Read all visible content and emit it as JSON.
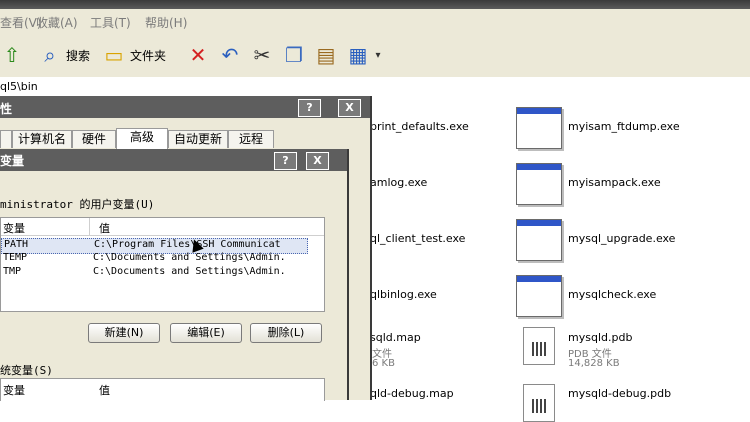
{
  "menu": [
    "查看(V)",
    "收藏(A)",
    "工具(T)",
    "帮助(H)"
  ],
  "toolbar": {
    "search_label": "搜索",
    "folders_label": "文件夹"
  },
  "address": "ql5\\bin",
  "files": {
    "col1": [
      {
        "name": "print_defaults.exe"
      },
      {
        "name": "amlog.exe"
      },
      {
        "name": "ql_client_test.exe"
      },
      {
        "name": "qlbinlog.exe"
      },
      {
        "name": "sqld.map",
        "type": "文件",
        "size": "6 KB"
      },
      {
        "name": "qld-debug.map"
      }
    ],
    "col2": [
      {
        "name": "myisam_ftdump.exe"
      },
      {
        "name": "myisampack.exe"
      },
      {
        "name": "mysql_upgrade.exe"
      },
      {
        "name": "mysqlcheck.exe"
      },
      {
        "name": "mysqld.pdb",
        "type": "PDB 文件",
        "size": "14,828 KB"
      },
      {
        "name": "mysqld-debug.pdb"
      }
    ]
  },
  "sysprop_dialog": {
    "title": "性",
    "help": "?",
    "close": "X",
    "tabs": [
      "计算机名",
      "硬件",
      "高级",
      "自动更新",
      "远程"
    ],
    "active_tab": "高级"
  },
  "env_dialog": {
    "title": "变量",
    "help": "?",
    "close": "X",
    "user_vars_label": "ministrator 的用户变量(U)",
    "columns": {
      "variable": "变量",
      "value": "值"
    },
    "rows": [
      {
        "var": "PATH",
        "value": "C:\\Program Files\\SSH Communicat",
        "selected": true
      },
      {
        "var": "TEMP",
        "value": "C:\\Documents and Settings\\Admin.",
        "selected": false
      },
      {
        "var": "TMP",
        "value": "C:\\Documents and Settings\\Admin.",
        "selected": false
      }
    ],
    "buttons": {
      "new": "新建(N)",
      "edit": "编辑(E)",
      "delete": "删除(L)"
    },
    "system_vars_label": "统变量(S)",
    "sys_columns": {
      "variable": "变量",
      "value": "值"
    }
  }
}
